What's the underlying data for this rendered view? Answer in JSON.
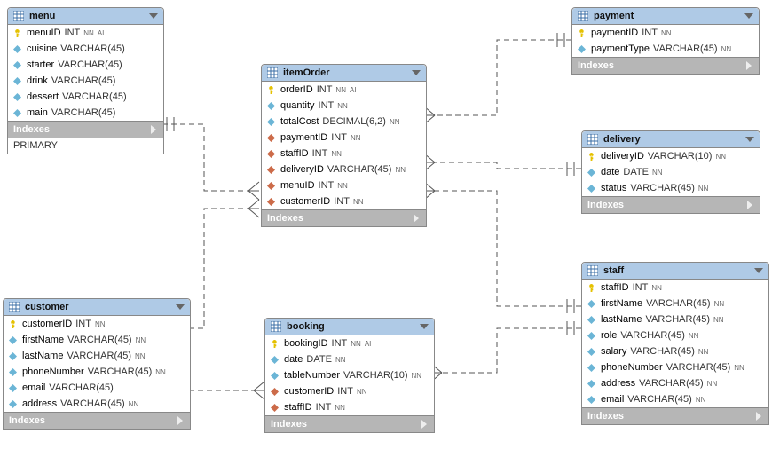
{
  "indexes_label": "Indexes",
  "tables": {
    "menu": {
      "title": "menu",
      "columns": [
        {
          "icon": "pk",
          "name": "menuID",
          "type": "INT",
          "tags": [
            "NN",
            "AI"
          ]
        },
        {
          "icon": "attr",
          "name": "cuisine",
          "type": "VARCHAR(45)",
          "tags": []
        },
        {
          "icon": "attr",
          "name": "starter",
          "type": "VARCHAR(45)",
          "tags": []
        },
        {
          "icon": "attr",
          "name": "drink",
          "type": "VARCHAR(45)",
          "tags": []
        },
        {
          "icon": "attr",
          "name": "dessert",
          "type": "VARCHAR(45)",
          "tags": []
        },
        {
          "icon": "attr",
          "name": "main",
          "type": "VARCHAR(45)",
          "tags": []
        }
      ],
      "indexes_visible": true,
      "primary_index_label": "PRIMARY"
    },
    "itemOrder": {
      "title": "itemOrder",
      "columns": [
        {
          "icon": "pk",
          "name": "orderID",
          "type": "INT",
          "tags": [
            "NN",
            "AI"
          ]
        },
        {
          "icon": "attr",
          "name": "quantity",
          "type": "INT",
          "tags": [
            "NN"
          ]
        },
        {
          "icon": "attr",
          "name": "totalCost",
          "type": "DECIMAL(6,2)",
          "tags": [
            "NN"
          ]
        },
        {
          "icon": "fk",
          "name": "paymentID",
          "type": "INT",
          "tags": [
            "NN"
          ]
        },
        {
          "icon": "fk",
          "name": "staffID",
          "type": "INT",
          "tags": [
            "NN"
          ]
        },
        {
          "icon": "fk",
          "name": "deliveryID",
          "type": "VARCHAR(45)",
          "tags": [
            "NN"
          ]
        },
        {
          "icon": "fk",
          "name": "menuID",
          "type": "INT",
          "tags": [
            "NN"
          ]
        },
        {
          "icon": "fk",
          "name": "customerID",
          "type": "INT",
          "tags": [
            "NN"
          ]
        }
      ],
      "indexes_visible": false
    },
    "payment": {
      "title": "payment",
      "columns": [
        {
          "icon": "pk",
          "name": "paymentID",
          "type": "INT",
          "tags": [
            "NN"
          ]
        },
        {
          "icon": "attr",
          "name": "paymentType",
          "type": "VARCHAR(45)",
          "tags": [
            "NN"
          ]
        }
      ],
      "indexes_visible": false
    },
    "delivery": {
      "title": "delivery",
      "columns": [
        {
          "icon": "pk",
          "name": "deliveryID",
          "type": "VARCHAR(10)",
          "tags": [
            "NN"
          ]
        },
        {
          "icon": "attr",
          "name": "date",
          "type": "DATE",
          "tags": [
            "NN"
          ]
        },
        {
          "icon": "attr",
          "name": "status",
          "type": "VARCHAR(45)",
          "tags": [
            "NN"
          ]
        }
      ],
      "indexes_visible": false
    },
    "staff": {
      "title": "staff",
      "columns": [
        {
          "icon": "pk",
          "name": "staffID",
          "type": "INT",
          "tags": [
            "NN"
          ]
        },
        {
          "icon": "attr",
          "name": "firstName",
          "type": "VARCHAR(45)",
          "tags": [
            "NN"
          ]
        },
        {
          "icon": "attr",
          "name": "lastName",
          "type": "VARCHAR(45)",
          "tags": [
            "NN"
          ]
        },
        {
          "icon": "attr",
          "name": "role",
          "type": "VARCHAR(45)",
          "tags": [
            "NN"
          ]
        },
        {
          "icon": "attr",
          "name": "salary",
          "type": "VARCHAR(45)",
          "tags": [
            "NN"
          ]
        },
        {
          "icon": "attr",
          "name": "phoneNumber",
          "type": "VARCHAR(45)",
          "tags": [
            "NN"
          ]
        },
        {
          "icon": "attr",
          "name": "address",
          "type": "VARCHAR(45)",
          "tags": [
            "NN"
          ]
        },
        {
          "icon": "attr",
          "name": "email",
          "type": "VARCHAR(45)",
          "tags": [
            "NN"
          ]
        }
      ],
      "indexes_visible": false
    },
    "customer": {
      "title": "customer",
      "columns": [
        {
          "icon": "pk",
          "name": "customerID",
          "type": "INT",
          "tags": [
            "NN"
          ]
        },
        {
          "icon": "attr",
          "name": "firstName",
          "type": "VARCHAR(45)",
          "tags": [
            "NN"
          ]
        },
        {
          "icon": "attr",
          "name": "lastName",
          "type": "VARCHAR(45)",
          "tags": [
            "NN"
          ]
        },
        {
          "icon": "attr",
          "name": "phoneNumber",
          "type": "VARCHAR(45)",
          "tags": [
            "NN"
          ]
        },
        {
          "icon": "attr",
          "name": "email",
          "type": "VARCHAR(45)",
          "tags": []
        },
        {
          "icon": "attr",
          "name": "address",
          "type": "VARCHAR(45)",
          "tags": [
            "NN"
          ]
        }
      ],
      "indexes_visible": false
    },
    "booking": {
      "title": "booking",
      "columns": [
        {
          "icon": "pk",
          "name": "bookingID",
          "type": "INT",
          "tags": [
            "NN",
            "AI"
          ]
        },
        {
          "icon": "attr",
          "name": "date",
          "type": "DATE",
          "tags": [
            "NN"
          ]
        },
        {
          "icon": "attr",
          "name": "tableNumber",
          "type": "VARCHAR(10)",
          "tags": [
            "NN"
          ]
        },
        {
          "icon": "fk",
          "name": "customerID",
          "type": "INT",
          "tags": [
            "NN"
          ]
        },
        {
          "icon": "fk",
          "name": "staffID",
          "type": "INT",
          "tags": [
            "NN"
          ]
        }
      ],
      "indexes_visible": false
    }
  },
  "relationships": [
    {
      "from": "menu",
      "to": "itemOrder"
    },
    {
      "from": "payment",
      "to": "itemOrder"
    },
    {
      "from": "delivery",
      "to": "itemOrder"
    },
    {
      "from": "staff",
      "to": "itemOrder"
    },
    {
      "from": "customer",
      "to": "itemOrder"
    },
    {
      "from": "customer",
      "to": "booking"
    },
    {
      "from": "staff",
      "to": "booking"
    }
  ]
}
